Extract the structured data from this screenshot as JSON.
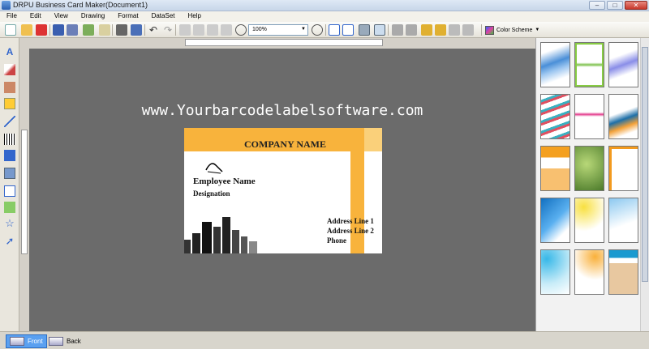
{
  "window": {
    "title": "DRPU Business Card Maker(Document1)"
  },
  "menu": [
    "File",
    "Edit",
    "View",
    "Drawing",
    "Format",
    "DataSet",
    "Help"
  ],
  "toolbar": {
    "zoom": "100%",
    "color_scheme_label": "Color Scheme"
  },
  "canvas": {
    "watermark": "www.Yourbarcodelabelsoftware.com"
  },
  "card": {
    "company": "COMPANY NAME",
    "employee": "Employee Name",
    "designation": "Designation",
    "address1": "Address Line 1",
    "address2": "Address Line 2",
    "phone": "Phone",
    "accent_color": "#f8b33c"
  },
  "bottom_tabs": {
    "front": "Front",
    "back": "Back"
  },
  "templates": [
    "blue-wave",
    "green-leaf",
    "lavender-swirl",
    "diagonal-stripes",
    "paint-splash",
    "teal-curve",
    "orange-blocks",
    "green-sparkle",
    "orange-frame",
    "blue-diamonds",
    "yellow-swirl",
    "sky-wave",
    "aqua-glow",
    "sunburst-dots",
    "tan-rays"
  ]
}
